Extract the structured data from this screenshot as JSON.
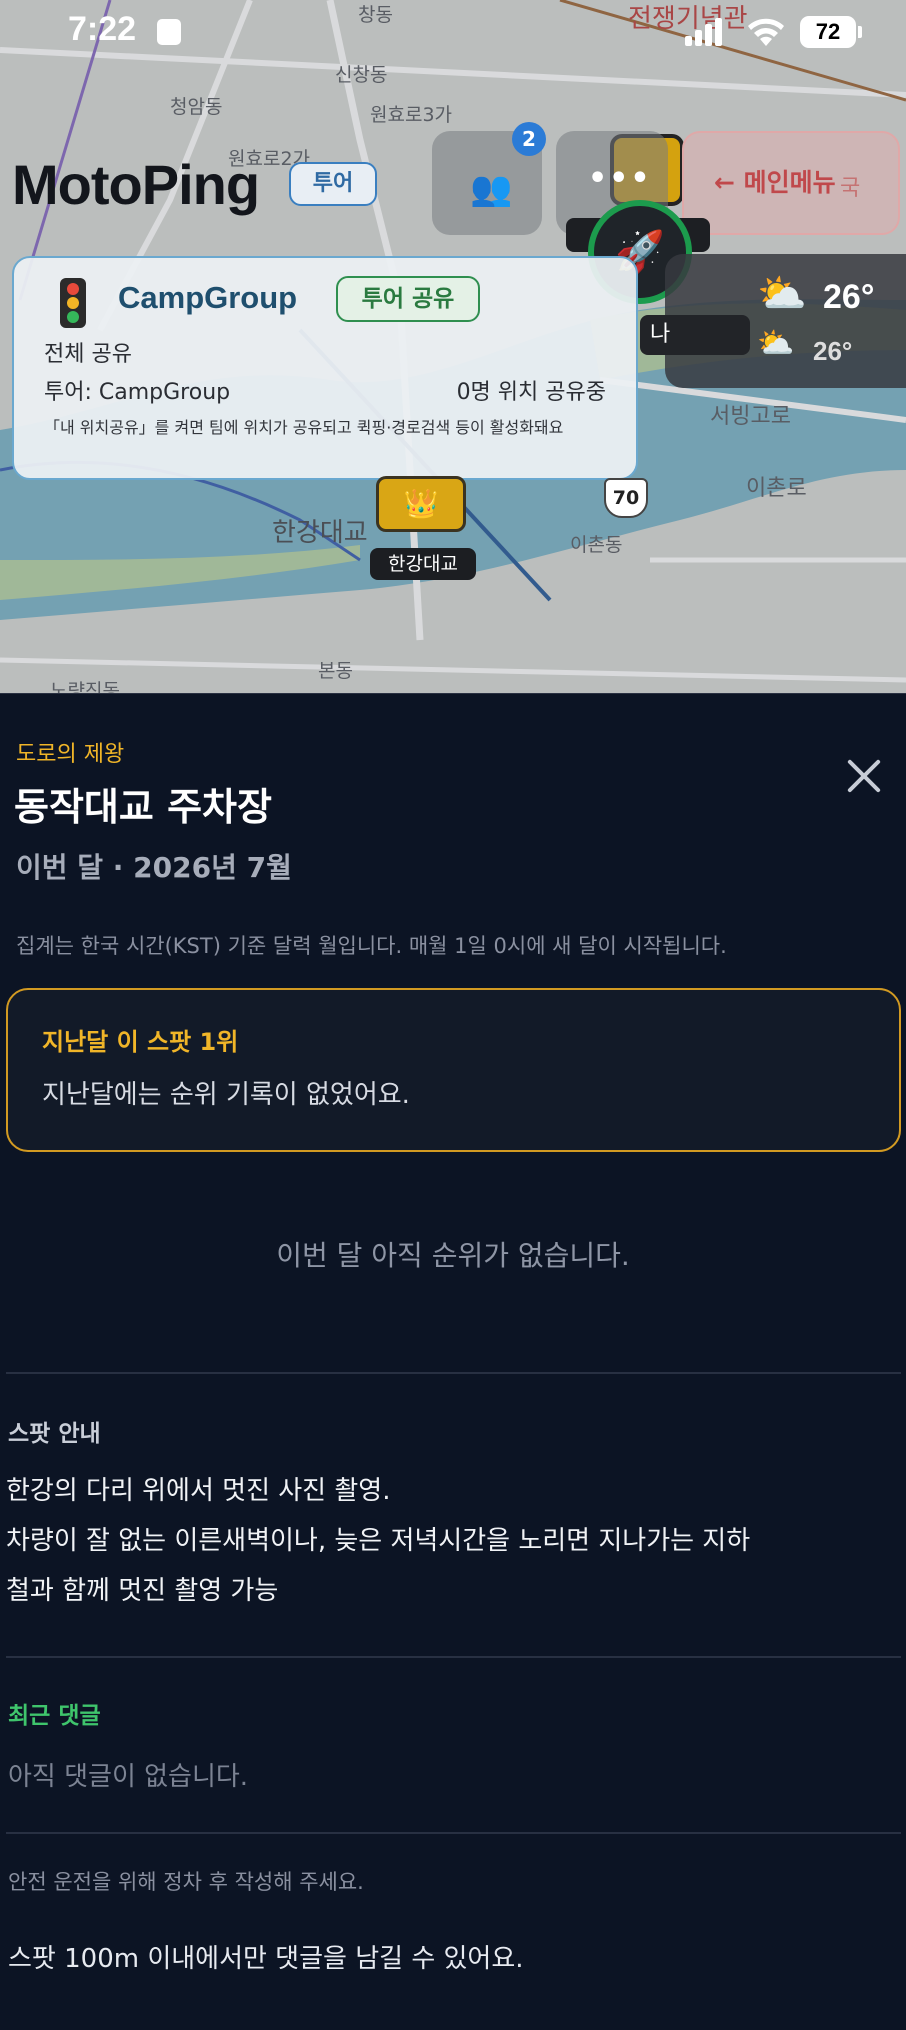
{
  "status_bar": {
    "time": "7:22",
    "battery": "72"
  },
  "map": {
    "labels": {
      "changdong": "창동",
      "sinchangdong": "신창동",
      "cheongamdong": "청암동",
      "wonhyoro3": "원효로3가",
      "wonhyoro2": "원효로2가",
      "memorial": "전쟁기념관",
      "hangang_bridge": "한강대교",
      "seobinggoro": "서빙고로",
      "ichonro": "이촌로",
      "ichondong": "이촌동",
      "bondong": "본동",
      "noryangjin": "노량진동",
      "guk": "국"
    },
    "app_title": "MotoPing",
    "tour_badge": "투어",
    "people_count": "2",
    "main_menu": "← 메인메뉴",
    "me_marker": "나",
    "weather": {
      "temp": "26°",
      "temp_small": "26°"
    },
    "camp_card": {
      "name": "CampGroup",
      "share_badge": "투어 공유",
      "all_share": "전체 공유",
      "tour_line": "투어: CampGroup",
      "sharing_count": "0명 위치 공유중",
      "note": "「내 위치공유」를 켜면 팀에 위치가 공유되고 퀵핑·경로검색 등이 활성화돼요"
    },
    "hangang_tag": "한강대교",
    "route_number": "70"
  },
  "sheet": {
    "category": "도로의 제왕",
    "title": "동작대교 주차장",
    "period": "이번 달 · 2026년 7월",
    "kst_note": "집계는 한국 시간(KST) 기준 달력 월입니다. 매월 1일 0시에 새 달이 시작됩니다.",
    "last_month": {
      "title": "지난달 이 스팟 1위",
      "body": "지난달에는 순위 기록이 없었어요."
    },
    "no_rank": "이번 달 아직 순위가 없습니다.",
    "guide": {
      "heading": "스팟 안내",
      "line1": "한강의 다리 위에서 멋진 사진 촬영.",
      "line2": "차량이 잘 없는 이른새벽이나, 늦은 저녁시간을 노리면 지나가는 지하",
      "line3": "철과 함께 멋진 촬영 가능"
    },
    "comments": {
      "heading": "최근 댓글",
      "empty": "아직 댓글이 없습니다."
    },
    "safe_note": "안전 운전을 위해 정차 후 작성해 주세요.",
    "range_note": "스팟 100m 이내에서만 댓글을 남길 수 있어요."
  },
  "colors": {
    "accent_gold": "#f0b528",
    "accent_green": "#3fc56c",
    "sheet_bg": "#0c1424"
  }
}
